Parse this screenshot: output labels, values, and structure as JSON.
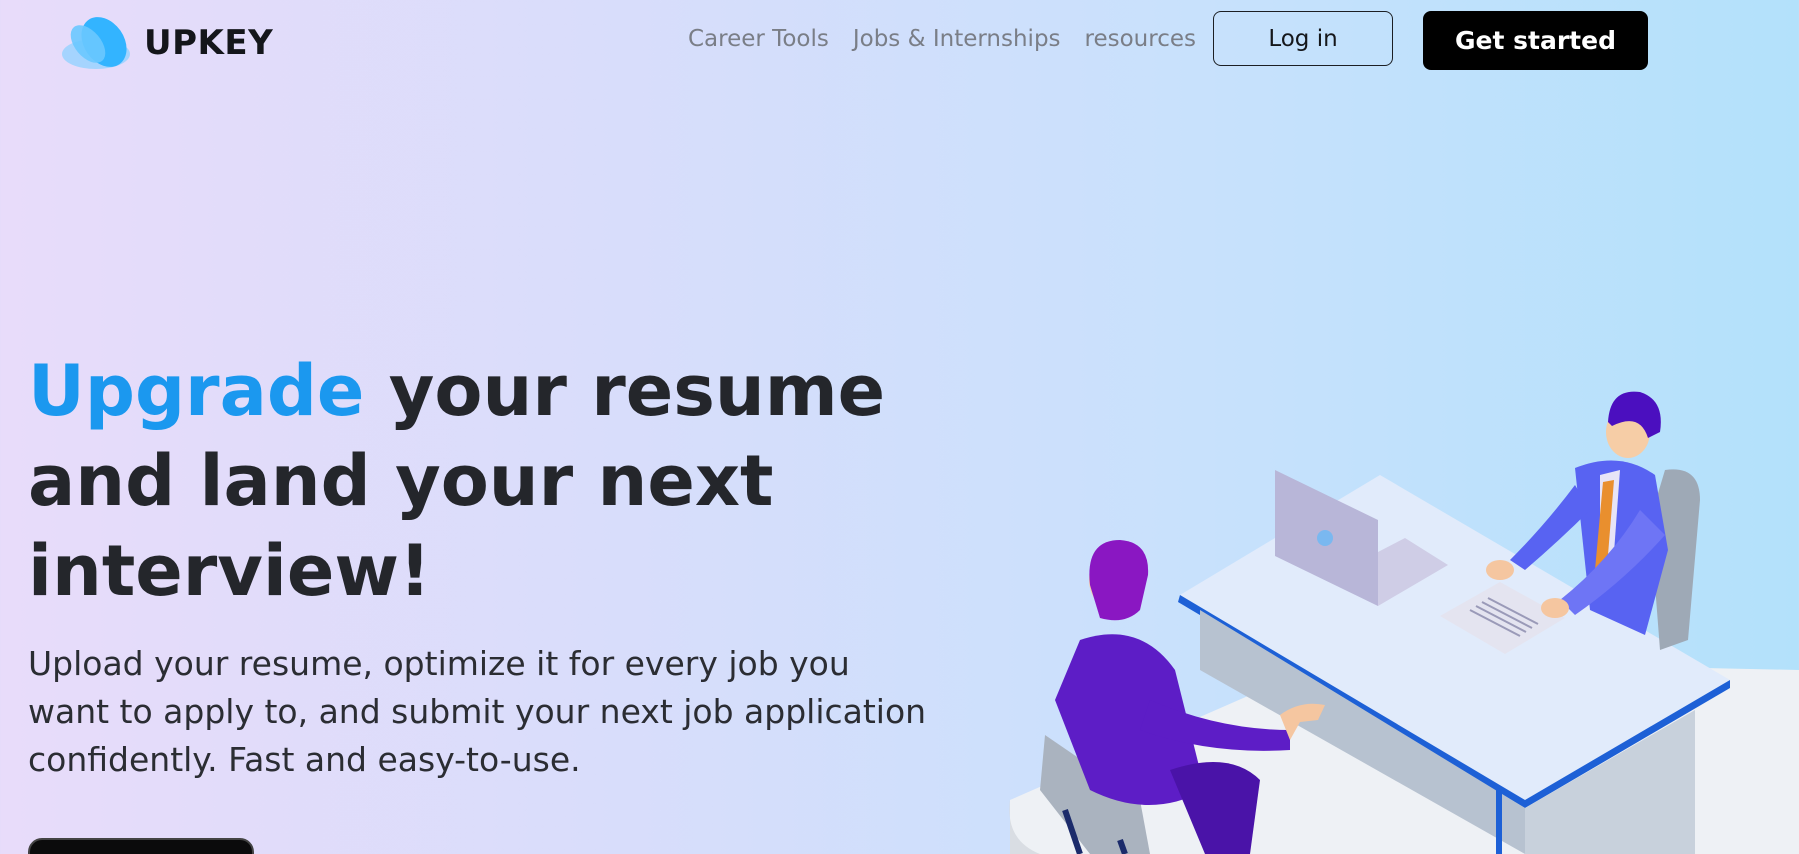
{
  "brand": {
    "name": "UPKEY",
    "logo_icon": "upkey-leaf-logo-icon",
    "logo_color": "#33b4ff"
  },
  "nav": {
    "items": [
      {
        "label": "Career Tools"
      },
      {
        "label": "Jobs & Internships"
      },
      {
        "label": "resources"
      }
    ]
  },
  "header_buttons": {
    "login_label": "Log in",
    "get_started_label": "Get started"
  },
  "hero": {
    "title_accent": "Upgrade",
    "title_rest": " your resume and land your next interview!",
    "subtitle": "Upload your resume, optimize it for every job you want to apply to, and submit your next job application confidently. Fast and easy-to-use.",
    "accent_color": "#1b98ef"
  },
  "illustration": {
    "description_icon": "job-interview-illustration-icon"
  }
}
